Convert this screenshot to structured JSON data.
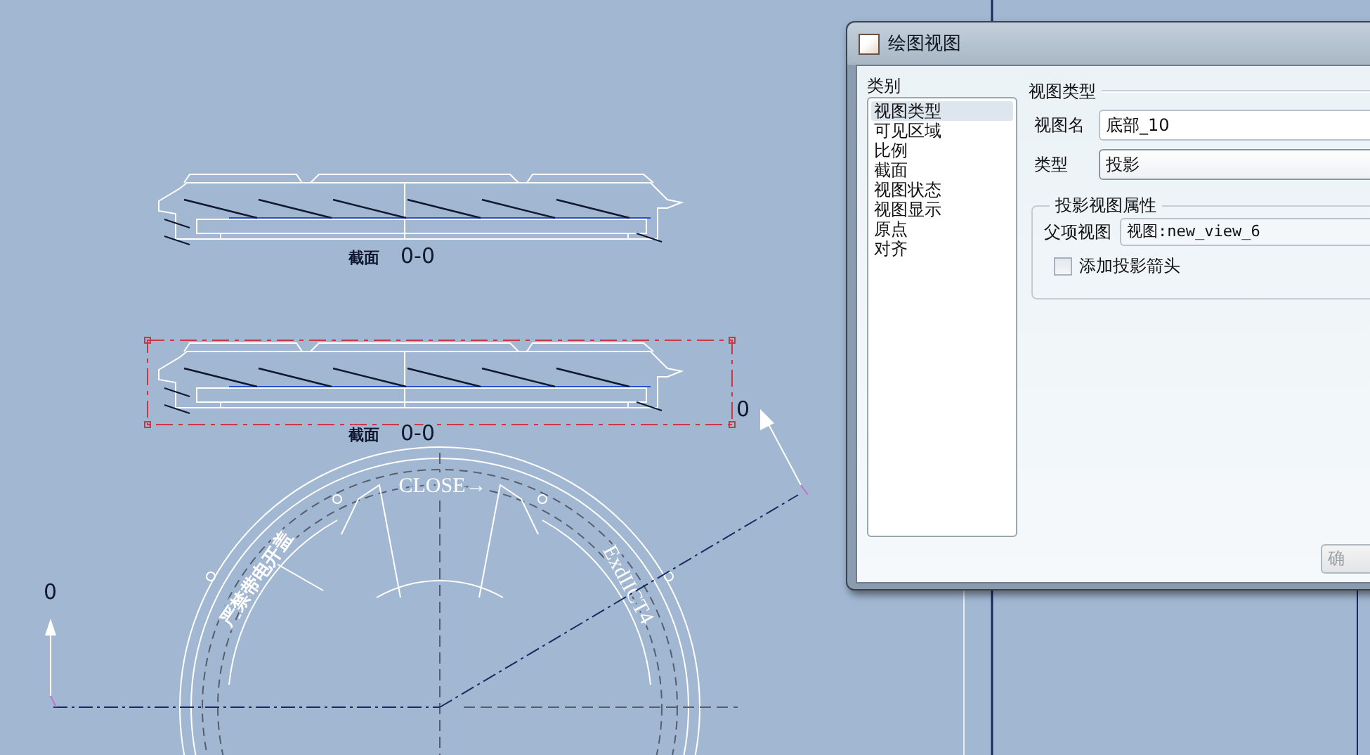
{
  "canvas": {
    "views": [
      {
        "label": "截面",
        "name": "0-0",
        "selected": false
      },
      {
        "label": "截面",
        "name": "0-0",
        "selected": true
      }
    ],
    "flange_texts": [
      "CLOSE→",
      "严禁带电开盖",
      "ExdIICT4"
    ],
    "axis_labels": [
      "0",
      "0"
    ]
  },
  "dialog": {
    "title": "绘图视图",
    "category_label": "类别",
    "categories": [
      {
        "label": "视图类型",
        "selected": true
      },
      {
        "label": "可见区域",
        "selected": false
      },
      {
        "label": "比例",
        "selected": false
      },
      {
        "label": "截面",
        "selected": false
      },
      {
        "label": "视图状态",
        "selected": false
      },
      {
        "label": "视图显示",
        "selected": false
      },
      {
        "label": "原点",
        "selected": false
      },
      {
        "label": "对齐",
        "selected": false
      }
    ],
    "section_title": "视图类型",
    "view_name": {
      "label": "视图名",
      "value": "底部_10"
    },
    "type": {
      "label": "类型",
      "value": "投影"
    },
    "group_title": "投影视图属性",
    "parent_view": {
      "label": "父项视图",
      "value": "视图:new_view_6"
    },
    "add_arrows": {
      "label": "添加投影箭头",
      "checked": false
    },
    "buttons": [
      {
        "label": "确",
        "disabled": true
      }
    ]
  }
}
